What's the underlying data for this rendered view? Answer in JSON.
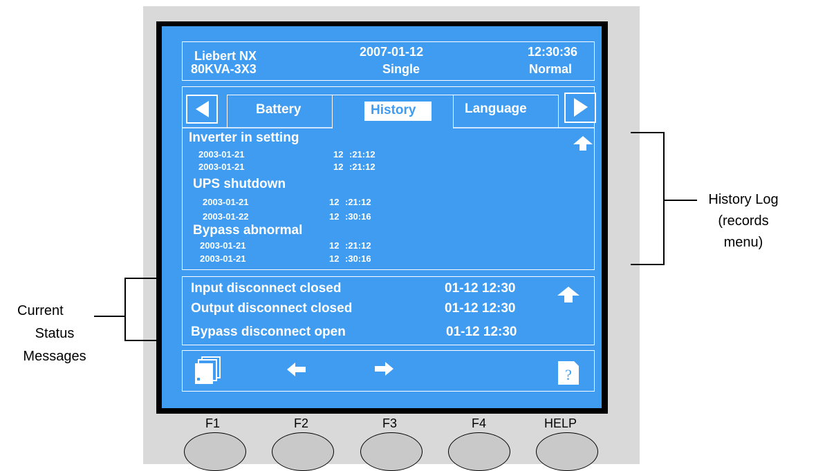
{
  "header": {
    "model": "Liebert NX",
    "rating": "80KVA-3X3",
    "date": "2007-01-12",
    "mode": "Single",
    "time": "12:30:36",
    "status": "Normal"
  },
  "tabs": [
    {
      "label": "Battery",
      "selected": false
    },
    {
      "label": "History",
      "selected": true
    },
    {
      "label": "Language",
      "selected": false
    }
  ],
  "history": [
    {
      "event": "Inverter in setting",
      "records": [
        {
          "date": "2003-01-21",
          "hour": "12",
          "time": ":21:12"
        },
        {
          "date": "2003-01-21",
          "hour": "12",
          "time": ":21:12"
        }
      ]
    },
    {
      "event": "UPS shutdown",
      "records": [
        {
          "date": "2003-01-21",
          "hour": "12",
          "time": ":21:12"
        },
        {
          "date": "2003-01-22",
          "hour": "12",
          "time": ":30:16"
        }
      ]
    },
    {
      "event": "Bypass abnormal",
      "records": [
        {
          "date": "2003-01-21",
          "hour": "12",
          "time": ":21:12"
        },
        {
          "date": "2003-01-21",
          "hour": "12",
          "time": ":30:16"
        }
      ]
    }
  ],
  "status_messages": [
    {
      "text": "Input disconnect closed",
      "time": "01-12 12:30"
    },
    {
      "text": "Output disconnect closed",
      "time": "01-12 12:30"
    },
    {
      "text": "Bypass disconnect open",
      "time": "01-12 12:30"
    }
  ],
  "function_keys": [
    "F1",
    "F2",
    "F3",
    "F4",
    "HELP"
  ],
  "annotations": {
    "history_log": [
      "History Log",
      "(records",
      "menu)"
    ],
    "current_status": [
      "Current",
      "Status",
      "Messages"
    ]
  },
  "icons": {
    "left_tab_arrow": "triangle-left-icon",
    "right_tab_arrow": "triangle-right-icon",
    "scroll_up": "arrow-up-icon",
    "menu": "menu-pages-icon",
    "prev": "arrow-left-icon",
    "next": "arrow-right-icon",
    "help": "help-icon"
  },
  "colors": {
    "screen": "#3f9cf0",
    "bezel": "#d9d9d9",
    "text": "#ffffff"
  }
}
